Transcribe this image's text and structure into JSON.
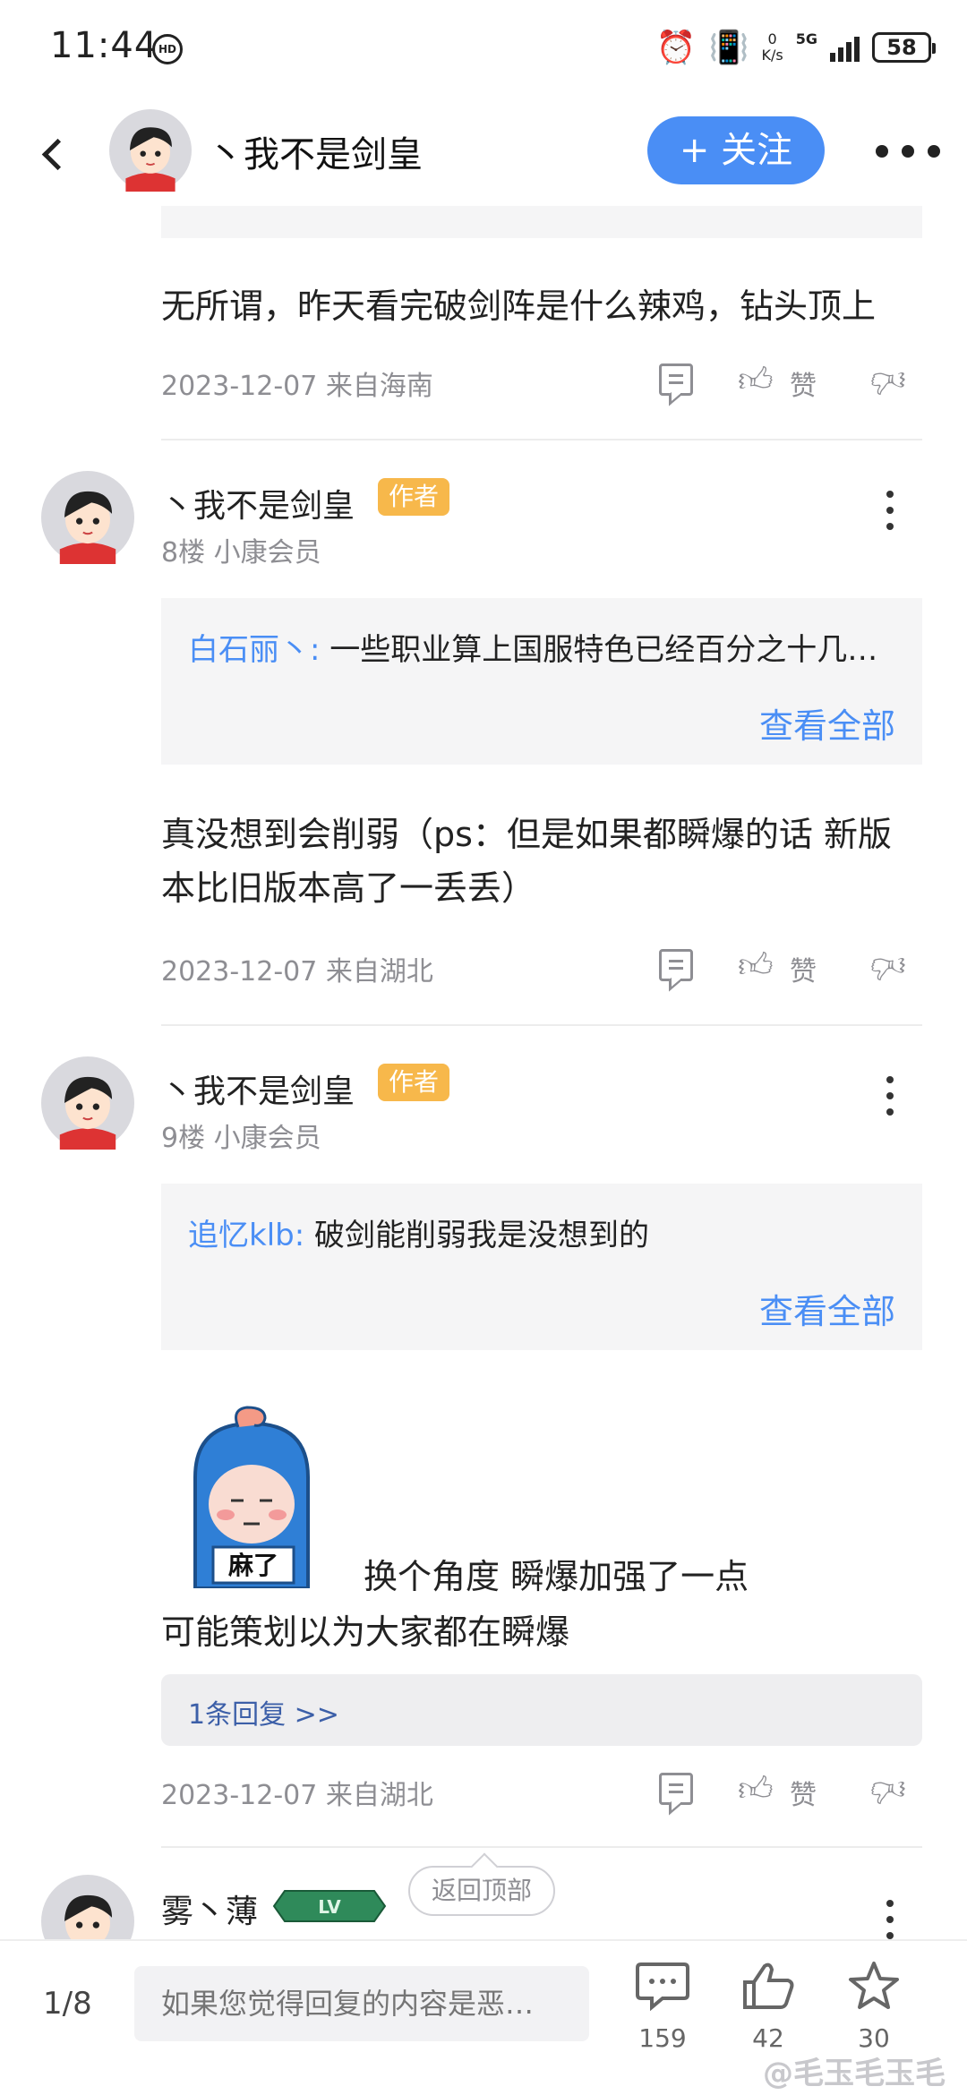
{
  "status_bar": {
    "time": "11:44",
    "hd": "HD",
    "speed_value": "0",
    "speed_unit": "K/s",
    "network": "5G",
    "battery": "58"
  },
  "header": {
    "username": "丶我不是剑皇",
    "follow_label": "+ 关注"
  },
  "comments": [
    {
      "text": "无所谓，昨天看完破剑阵是什么辣鸡，钻头顶上",
      "date": "2023-12-07 来自海南",
      "like_label": "赞"
    },
    {
      "username": "丶我不是剑皇",
      "author_badge": "作者",
      "floor": "8楼 小康会员",
      "quote_user": "白石丽丶:",
      "quote_text": " 一些职业算上国服特色已经百分之十几…",
      "view_all": "查看全部",
      "text": "真没想到会削弱（ps：但是如果都瞬爆的话 新版本比旧版本高了一丢丢）",
      "date": "2023-12-07 来自湖北",
      "like_label": "赞"
    },
    {
      "username": "丶我不是剑皇",
      "author_badge": "作者",
      "floor": "9楼 小康会员",
      "quote_user": "追忆klb:",
      "quote_text": " 破剑能削弱我是没想到的",
      "view_all": "查看全部",
      "sticker_caption": "麻了",
      "text_line1": "换个角度 瞬爆加强了一点",
      "text_line2": "可能策划以为大家都在瞬爆",
      "reply_count": "1条回复 >>",
      "date": "2023-12-07 来自湖北",
      "like_label": "赞"
    },
    {
      "username": "雾丶薄",
      "level_badge": "LV"
    }
  ],
  "back_to_top": "返回顶部",
  "bottom_bar": {
    "page": "1/8",
    "input_placeholder": "如果您觉得回复的内容是恶…",
    "comment_count": "159",
    "like_count": "42",
    "favorite_count": "30",
    "watermark": "@毛玉毛玉毛"
  },
  "colors": {
    "accent": "#4a8ef5",
    "author_badge": "#f7b84b",
    "meta_gray": "#8e8e93",
    "quote_bg": "#f5f5f6"
  }
}
